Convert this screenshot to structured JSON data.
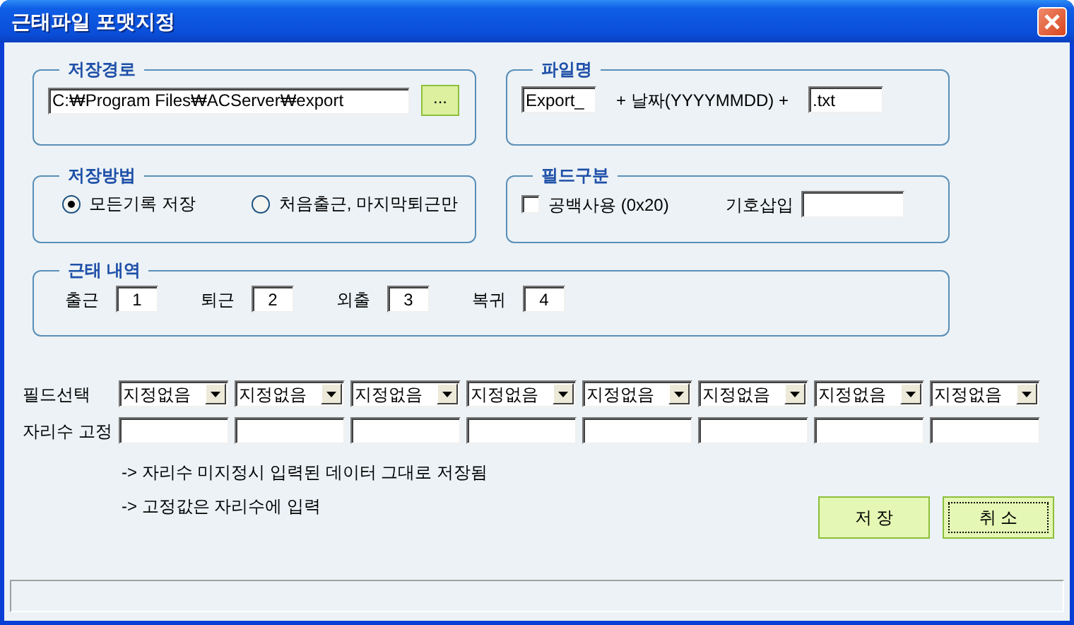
{
  "window": {
    "title": "근태파일 포맷지정"
  },
  "save_path": {
    "title": "저장경로",
    "value": "C:₩Program Files₩ACServer₩export",
    "browse_button": "..."
  },
  "file_name": {
    "title": "파일명",
    "prefix": "Export_",
    "date_label": "+ 날짜(YYYYMMDD) +",
    "extension": ".txt"
  },
  "save_method": {
    "title": "저장방법",
    "options": [
      {
        "label": "모든기록 저장",
        "selected": true
      },
      {
        "label": "처음출근, 마지막퇴근만",
        "selected": false
      }
    ]
  },
  "field_separator": {
    "title": "필드구분",
    "space_option": {
      "label": "공백사용 (0x20)",
      "checked": false
    },
    "symbol_label": "기호삽입"
  },
  "attendance": {
    "title": "근태 내역",
    "items": [
      {
        "label": "출근",
        "code": "1"
      },
      {
        "label": "퇴근",
        "code": "2"
      },
      {
        "label": "외출",
        "code": "3"
      },
      {
        "label": "복귀",
        "code": "4"
      }
    ]
  },
  "field_select": {
    "label": "필드선택",
    "combos": [
      "지정없음",
      "지정없음",
      "지정없음",
      "지정없음",
      "지정없음",
      "지정없음",
      "지정없음",
      "지정없음"
    ]
  },
  "fixed_width": {
    "label": "자리수 고정"
  },
  "notes": [
    "-> 자리수 미지정시 입력된 데이터 그대로 저장됨",
    "-> 고정값은 자리수에 입력"
  ],
  "buttons": [
    {
      "label": "저 장",
      "focused": false
    },
    {
      "label": "취 소",
      "focused": true
    }
  ]
}
